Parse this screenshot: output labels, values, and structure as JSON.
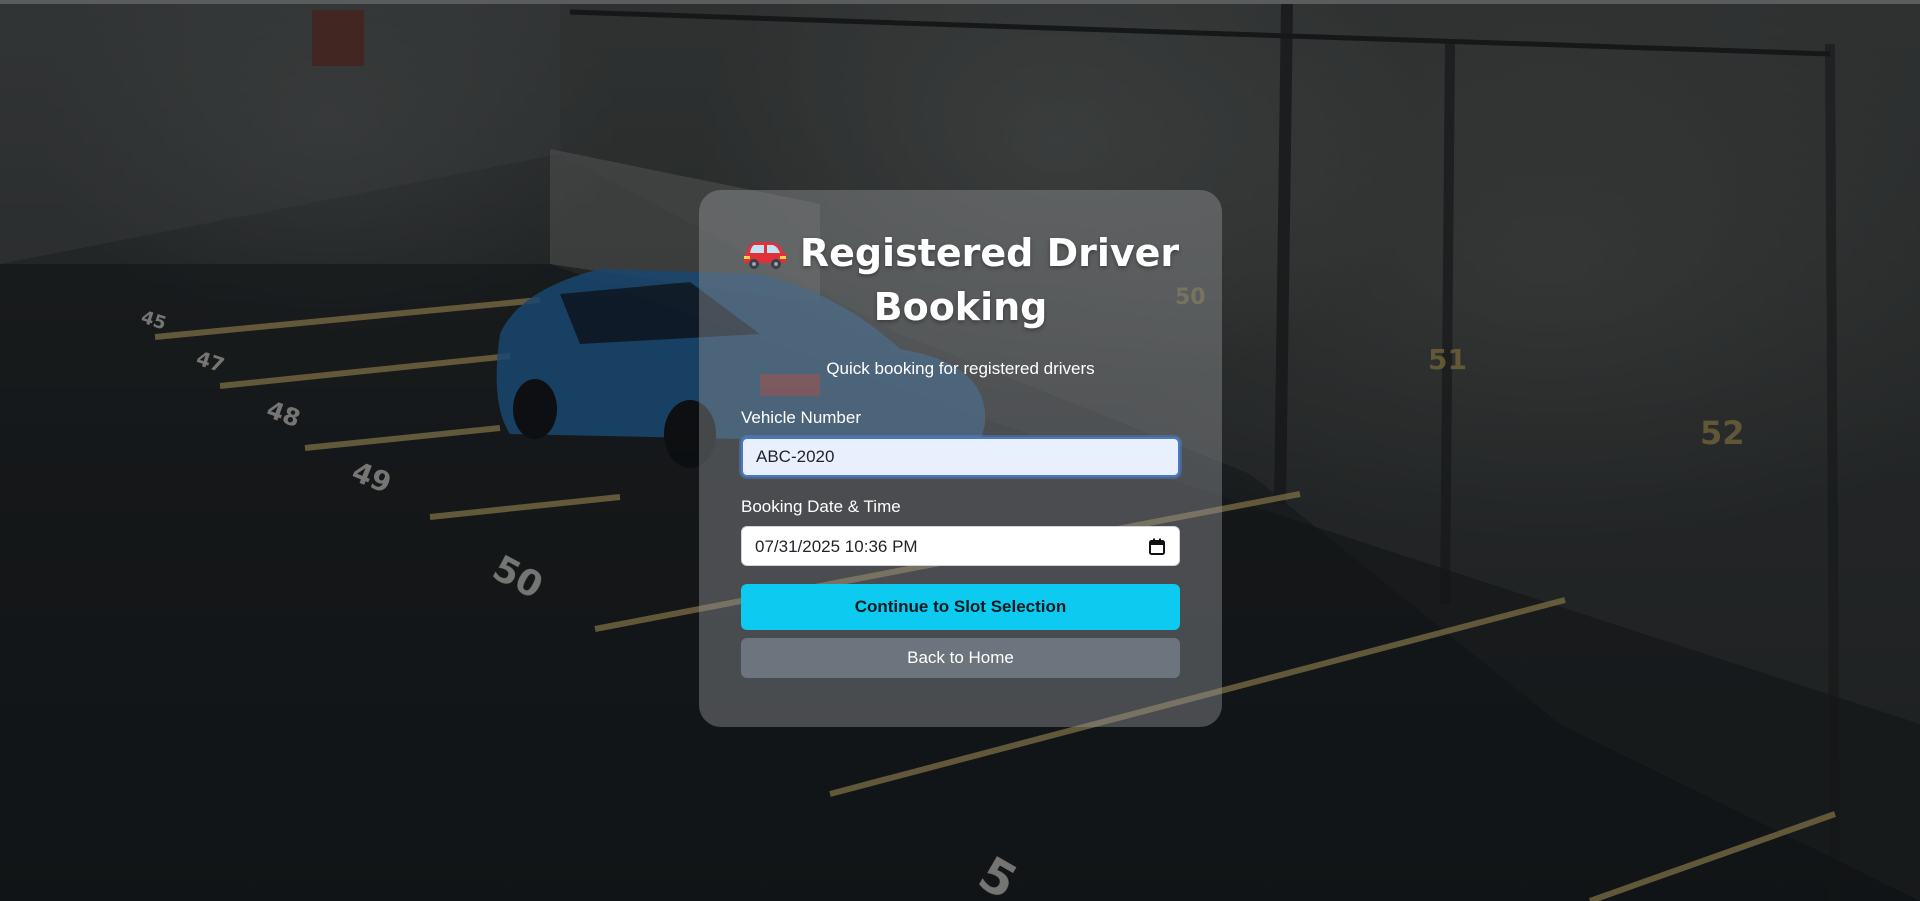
{
  "page": {
    "title": "Registered Driver Booking",
    "subtitle": "Quick booking for registered drivers",
    "title_icon": "car-icon"
  },
  "form": {
    "vehicle": {
      "label": "Vehicle Number",
      "value": "ABC-2020"
    },
    "datetime": {
      "label": "Booking Date & Time",
      "value": "07/31/2025 10:36 PM",
      "icon": "calendar-icon"
    },
    "continue_label": "Continue to Slot Selection",
    "back_label": "Back to Home"
  },
  "background": {
    "slot_numbers": [
      "45",
      "47",
      "48",
      "49",
      "50",
      "50",
      "51",
      "52",
      "5"
    ]
  },
  "colors": {
    "primary_button": "#0dcaf0",
    "secondary_button": "#6c757d",
    "input_focus_bg": "#e8f0fe",
    "card_bg": "rgba(150,152,156,0.42)"
  }
}
